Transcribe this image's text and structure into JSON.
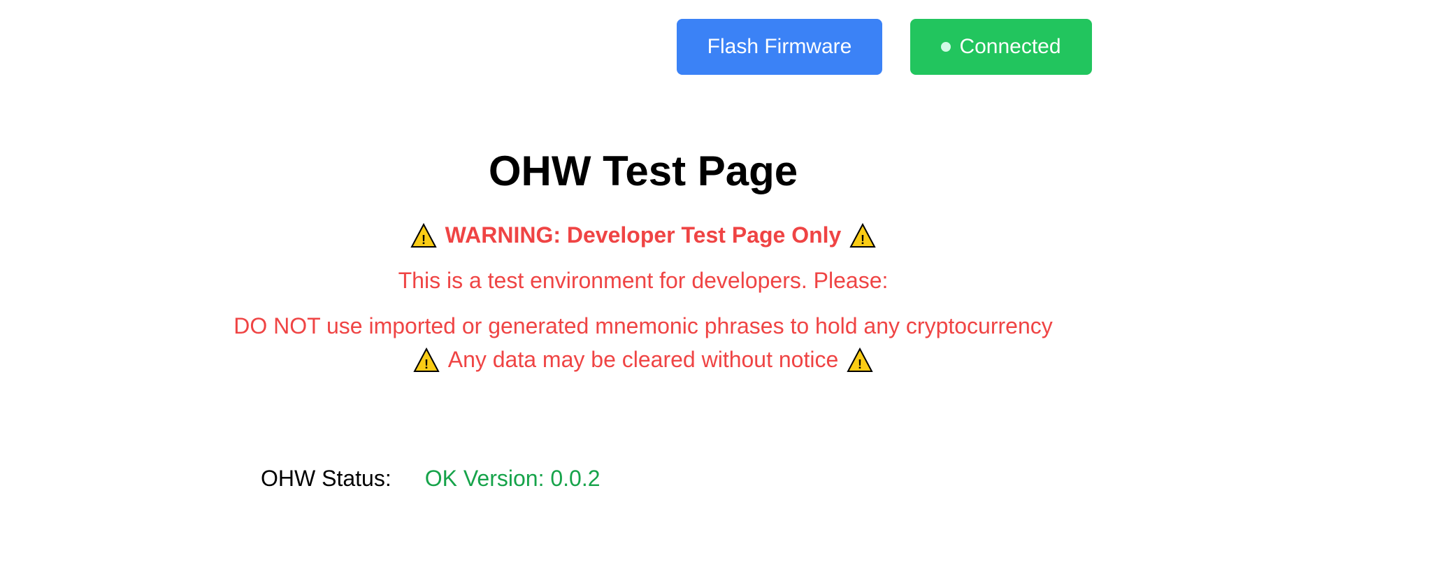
{
  "toolbar": {
    "flash_label": "Flash Firmware",
    "connected_label": "Connected",
    "colors": {
      "flash_bg": "#3b82f6",
      "connected_bg": "#22c55e"
    }
  },
  "main": {
    "title": "OHW Test Page",
    "warning_heading": "WARNING: Developer Test Page Only",
    "warning_intro": "This is a test environment for developers. Please:",
    "warning_dont": "DO NOT use imported or generated mnemonic phrases to hold any cryptocurrency",
    "warning_cleared": "Any data may be cleared without notice",
    "warning_color": "#ef4444",
    "warning_icon": "warning-triangle-icon"
  },
  "status": {
    "label": "OHW Status:",
    "value": "OK Version: 0.0.2",
    "value_color": "#16a34a"
  }
}
